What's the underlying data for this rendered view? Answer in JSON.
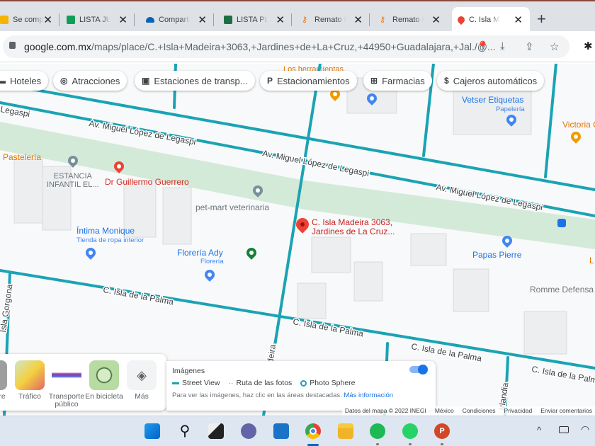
{
  "browser": {
    "tabs": [
      {
        "label": "Se compartió",
        "icon": "drive-icon",
        "color": "#f4b400"
      },
      {
        "label": "LISTA JULIO",
        "icon": "sheets-cross-icon",
        "color": "#0f9d58"
      },
      {
        "label": "Compartido",
        "icon": "onedrive-icon",
        "color": "#0364b8"
      },
      {
        "label": "LISTA PLANTA",
        "icon": "excel-icon",
        "color": "#1d6f42"
      },
      {
        "label": "Remato Herramienta",
        "icon": "key-icon",
        "color": "#e8710a"
      },
      {
        "label": "Remato Herramienta",
        "icon": "key-icon",
        "color": "#e8710a"
      },
      {
        "label": "C. Isla Madeira",
        "icon": "maps-pin-icon",
        "color": "#ea4335",
        "active": true
      }
    ],
    "url_host": "google.com.mx",
    "url_path": "/maps/place/C.+Isla+Madeira+3063,+Jardines+de+La+Cruz,+44950+Guadalajara,+Jal./@..."
  },
  "chips": [
    {
      "label": "Hoteles",
      "icon": "bed-icon"
    },
    {
      "label": "Atracciones",
      "icon": "camera-icon"
    },
    {
      "label": "Estaciones de transp...",
      "icon": "bus-icon"
    },
    {
      "label": "Estacionamientos",
      "icon": "parking-icon"
    },
    {
      "label": "Farmacias",
      "icon": "pharmacy-icon"
    },
    {
      "label": "Cajeros automáticos",
      "icon": "atm-icon"
    }
  ],
  "map": {
    "streets": {
      "legaspi": "Av. Miguel López de Legaspi",
      "legaspi_cut": "Legaspi",
      "palma": "C. Isla de la Palma",
      "madeira": "Madeira",
      "gorgona": "Isla Gorgona",
      "isla": "Isla",
      "irlandia": "Irlandia"
    },
    "places": {
      "selected_line1": "C. Isla Madeira 3063,",
      "selected_line2": "Jardines de La Cruz...",
      "pasteleria": "Pastelería",
      "estancia1": "ESTANCIA",
      "estancia2": "INFANTIL EL...",
      "guerrero": "Dr Guillermo Guerrero",
      "petmart": "pet-mart veterinaria",
      "intima": "Íntima Monique",
      "intima_sub": "Tienda de ropa interior",
      "floreria": "Florería Ady",
      "floreria_sub": "Florería",
      "vetser": "Vetser Etiquetas",
      "vetser_sub": "Papelería",
      "victoria": "Victoria C",
      "papas": "Papas Pierre",
      "romme": "Romme Defensa",
      "hardware": "Los herramientas",
      "l_cut": "L"
    },
    "colors": {
      "road": "#1aa3b3",
      "park": "#d4ead8",
      "selected": "#ea4335"
    }
  },
  "layers": [
    {
      "label": "re"
    },
    {
      "label": "Tráfico"
    },
    {
      "label": "Transporte público"
    },
    {
      "label": "En bicicleta"
    },
    {
      "label": "Más"
    }
  ],
  "images_panel": {
    "title": "Imágenes",
    "street_view": "Street View",
    "photo_route": "Ruta de las fotos",
    "photo_sphere": "Photo Sphere",
    "hint": "Para ver las imágenes, haz clic en las áreas destacadas.",
    "more_info": "Más información",
    "toggle_on": true
  },
  "attribution": [
    "Datos del mapa © 2022 INEGI",
    "México",
    "Condiciones",
    "Privacidad",
    "Enviar comentarios"
  ],
  "taskbar": [
    "start",
    "search",
    "task-view",
    "teams",
    "mail",
    "chrome",
    "explorer",
    "spotify",
    "whatsapp",
    "powerpoint"
  ]
}
